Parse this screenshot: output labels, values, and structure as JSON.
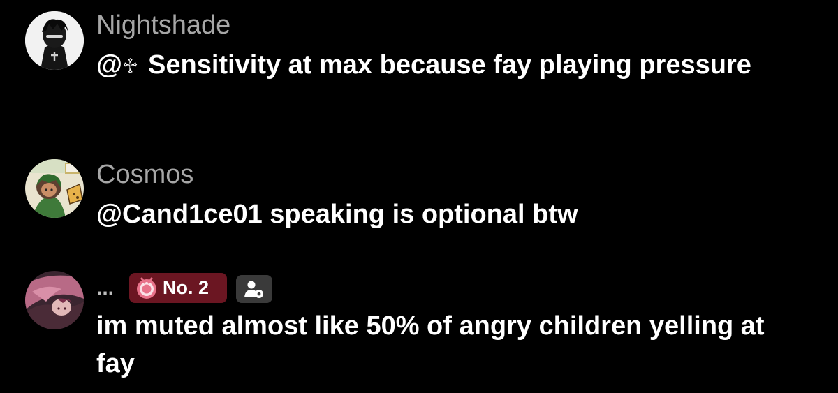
{
  "comments": [
    {
      "username": "Nightshade",
      "mention": "@",
      "mention_symbol": "♱",
      "text": "Sensitivity at max because fay playing pressure",
      "avatar_icon": "dark-figure-avatar"
    },
    {
      "username": "Cosmos",
      "mention": "@Cand1ce01",
      "text": " speaking is optional btw",
      "avatar_icon": "green-character-avatar"
    },
    {
      "username": "...",
      "rank_badge": "No. 2",
      "text": "im muted almost like 50% of angry children yelling at fay",
      "avatar_icon": "pink-character-avatar"
    }
  ],
  "colors": {
    "background": "#000000",
    "username": "#a6a6a6",
    "text": "#ffffff",
    "rank_badge_bg": "#6b1622",
    "user_badge_bg": "#3a3a3a",
    "medal_pink": "#e8728a"
  },
  "icons": {
    "rank_badge_icon": "medal-icon",
    "user_badge_icon": "user-settings-icon"
  }
}
